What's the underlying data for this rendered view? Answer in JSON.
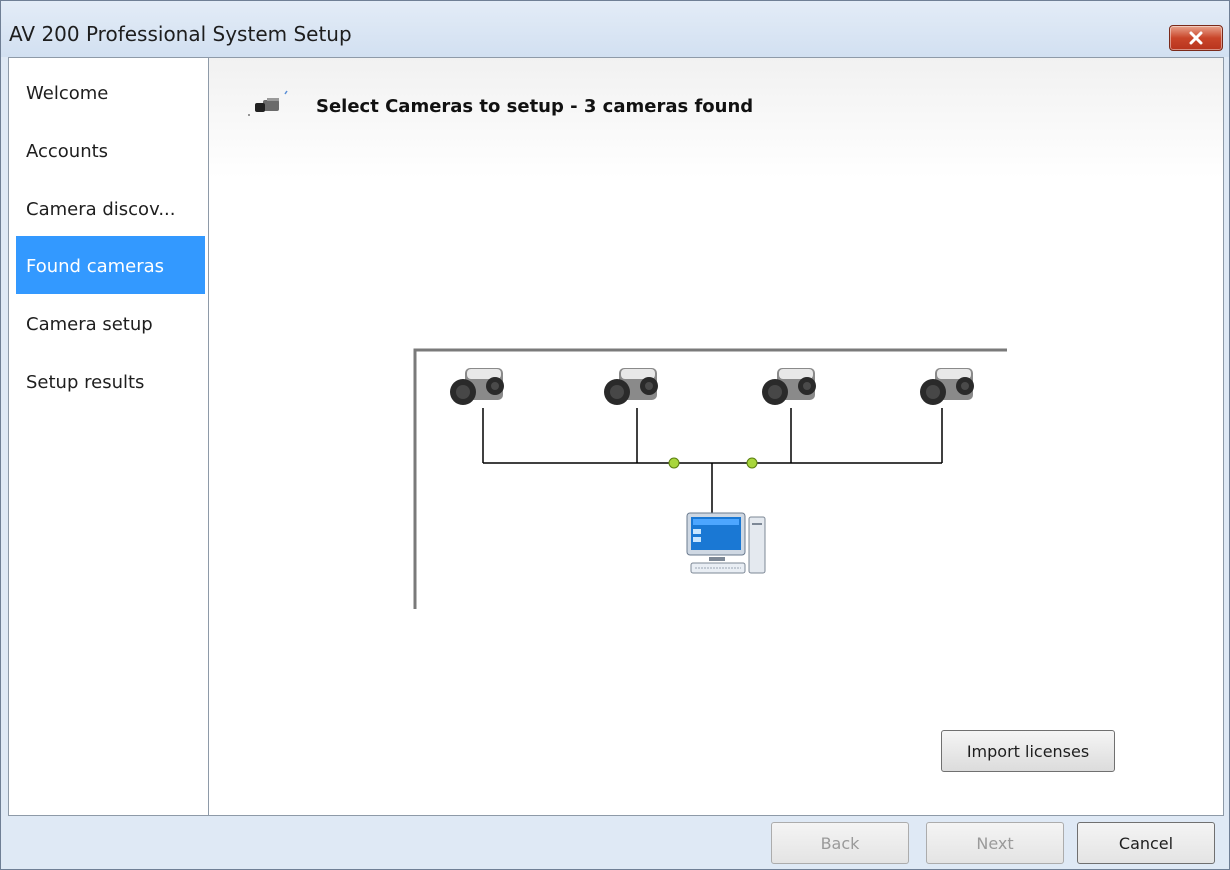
{
  "window": {
    "title": "AV 200 Professional System Setup",
    "close_icon": "close-x-icon"
  },
  "sidebar": {
    "items": [
      {
        "label": "Welcome",
        "active": false
      },
      {
        "label": "Accounts",
        "active": false
      },
      {
        "label": "Camera discov...",
        "active": false
      },
      {
        "label": "Found cameras",
        "active": true
      },
      {
        "label": "Camera setup",
        "active": false
      },
      {
        "label": "Setup results",
        "active": false
      }
    ]
  },
  "main": {
    "header": {
      "icon": "camera-icon",
      "title": "Select Cameras to setup - 3 cameras found"
    },
    "diagram": {
      "cameras": 4,
      "camera_icon": "security-camera-icon",
      "computer_icon": "computer-icon"
    },
    "import_label": "Import licenses"
  },
  "footer": {
    "back_label": "Back",
    "next_label": "Next",
    "cancel_label": "Cancel",
    "back_enabled": false,
    "next_enabled": false,
    "cancel_enabled": true
  },
  "colors": {
    "selection": "#3399ff",
    "close_button": "#c9452a",
    "chrome": "#dfe9f5",
    "node_dot": "#a8d63c"
  }
}
